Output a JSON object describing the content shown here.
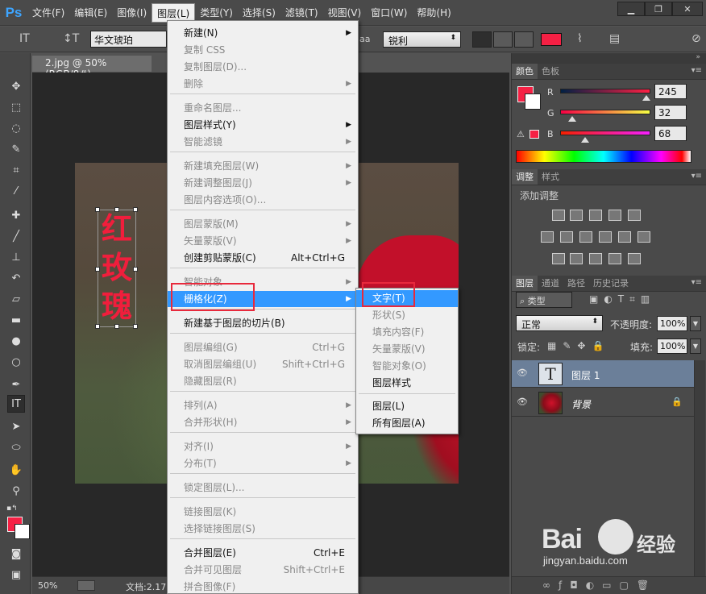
{
  "app": {
    "logo": "Ps"
  },
  "menubar": {
    "items": [
      "文件(F)",
      "编辑(E)",
      "图像(I)",
      "图层(L)",
      "类型(Y)",
      "选择(S)",
      "滤镜(T)",
      "视图(V)",
      "窗口(W)",
      "帮助(H)"
    ],
    "active_index": 3
  },
  "options": {
    "font_family": "华文琥珀",
    "aa_label": "aa",
    "aa_value": "锐利",
    "text_color": "#f52044"
  },
  "document": {
    "tab": "2.jpg @ 50%(RGB/8#)",
    "glyphs": [
      "红",
      "玫",
      "瑰"
    ]
  },
  "status": {
    "zoom": "50%",
    "doc": "文档:2.17"
  },
  "color_panel": {
    "tabs": [
      "颜色",
      "色板"
    ],
    "channels": [
      {
        "label": "R",
        "value": "245",
        "level": 0.96
      },
      {
        "label": "G",
        "value": "32",
        "level": 0.13
      },
      {
        "label": "B",
        "value": "68",
        "level": 0.27
      }
    ],
    "fg": "#f52044"
  },
  "adjust_panel": {
    "tabs": [
      "调整",
      "样式"
    ],
    "title": "添加调整"
  },
  "layers_panel": {
    "tabs": [
      "图层",
      "通道",
      "路径",
      "历史记录"
    ],
    "filter": "类型",
    "blend_mode": "正常",
    "opacity_label": "不透明度:",
    "opacity": "100%",
    "lock_label": "锁定:",
    "fill_label": "填充:",
    "fill": "100%",
    "layers": [
      {
        "name": "图层 1",
        "thumb": "T",
        "selected": true
      },
      {
        "name": "背景",
        "thumb": "",
        "selected": false
      }
    ]
  },
  "layer_menu": {
    "items": [
      {
        "label": "新建(N)",
        "shortcut": "",
        "arrow": true,
        "disabled": false
      },
      {
        "label": "复制 CSS",
        "shortcut": "",
        "arrow": false,
        "disabled": true
      },
      {
        "label": "复制图层(D)...",
        "shortcut": "",
        "arrow": false,
        "disabled": true
      },
      {
        "label": "删除",
        "shortcut": "",
        "arrow": true,
        "disabled": true
      },
      {
        "label": "重命名图层...",
        "shortcut": "",
        "arrow": false,
        "disabled": true
      },
      {
        "label": "图层样式(Y)",
        "shortcut": "",
        "arrow": true,
        "disabled": false
      },
      {
        "label": "智能滤镜",
        "shortcut": "",
        "arrow": true,
        "disabled": true
      },
      {
        "label": "新建填充图层(W)",
        "shortcut": "",
        "arrow": true,
        "disabled": true
      },
      {
        "label": "新建调整图层(J)",
        "shortcut": "",
        "arrow": true,
        "disabled": true
      },
      {
        "label": "图层内容选项(O)...",
        "shortcut": "",
        "arrow": false,
        "disabled": true
      },
      {
        "label": "图层蒙版(M)",
        "shortcut": "",
        "arrow": true,
        "disabled": true
      },
      {
        "label": "矢量蒙版(V)",
        "shortcut": "",
        "arrow": true,
        "disabled": true
      },
      {
        "label": "创建剪贴蒙版(C)",
        "shortcut": "Alt+Ctrl+G",
        "arrow": false,
        "disabled": false
      },
      {
        "label": "智能对象",
        "shortcut": "",
        "arrow": true,
        "disabled": true
      },
      {
        "label": "栅格化(Z)",
        "shortcut": "",
        "arrow": true,
        "disabled": false
      },
      {
        "label": "新建基于图层的切片(B)",
        "shortcut": "",
        "arrow": false,
        "disabled": false
      },
      {
        "label": "图层编组(G)",
        "shortcut": "Ctrl+G",
        "arrow": false,
        "disabled": true
      },
      {
        "label": "取消图层编组(U)",
        "shortcut": "Shift+Ctrl+G",
        "arrow": false,
        "disabled": true
      },
      {
        "label": "隐藏图层(R)",
        "shortcut": "",
        "arrow": false,
        "disabled": true
      },
      {
        "label": "排列(A)",
        "shortcut": "",
        "arrow": true,
        "disabled": true
      },
      {
        "label": "合并形状(H)",
        "shortcut": "",
        "arrow": true,
        "disabled": true
      },
      {
        "label": "对齐(I)",
        "shortcut": "",
        "arrow": true,
        "disabled": true
      },
      {
        "label": "分布(T)",
        "shortcut": "",
        "arrow": true,
        "disabled": true
      },
      {
        "label": "锁定图层(L)...",
        "shortcut": "",
        "arrow": false,
        "disabled": true
      },
      {
        "label": "链接图层(K)",
        "shortcut": "",
        "arrow": false,
        "disabled": true
      },
      {
        "label": "选择链接图层(S)",
        "shortcut": "",
        "arrow": false,
        "disabled": true
      },
      {
        "label": "合并图层(E)",
        "shortcut": "Ctrl+E",
        "arrow": false,
        "disabled": false
      },
      {
        "label": "合并可见图层",
        "shortcut": "Shift+Ctrl+E",
        "arrow": false,
        "disabled": true
      },
      {
        "label": "拼合图像(F)",
        "shortcut": "",
        "arrow": false,
        "disabled": true
      }
    ],
    "highlight_index": 14
  },
  "raster_menu": {
    "items": [
      {
        "label": "文字(T)",
        "disabled": false
      },
      {
        "label": "形状(S)",
        "disabled": true
      },
      {
        "label": "填充内容(F)",
        "disabled": true
      },
      {
        "label": "矢量蒙版(V)",
        "disabled": true
      },
      {
        "label": "智能对象(O)",
        "disabled": true
      },
      {
        "label": "图层样式",
        "disabled": false
      },
      {
        "label": "图层(L)",
        "disabled": false
      },
      {
        "label": "所有图层(A)",
        "disabled": false
      }
    ],
    "highlight_index": 0
  },
  "watermark": {
    "brand": "Bai",
    "product": "经验",
    "url": "jingyan.baidu.com"
  }
}
